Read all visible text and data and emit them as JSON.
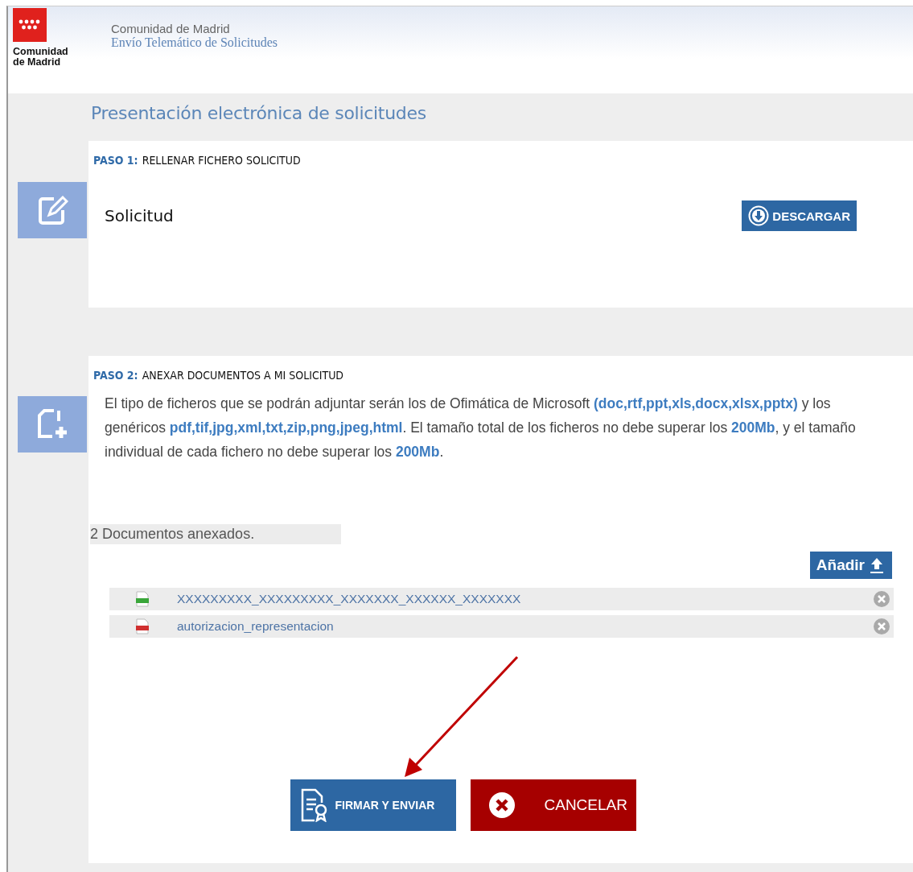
{
  "header": {
    "logo_text": "Comunidad de Madrid",
    "org": "Comunidad de Madrid",
    "app": "Envío Telemático de Solicitudes"
  },
  "title": "Presentación electrónica de solicitudes",
  "step1": {
    "label": "PASO 1:",
    "heading": "RELLENAR FICHERO SOLICITUD",
    "item": "Solicitud",
    "button": "DESCARGAR"
  },
  "step2": {
    "label": "PASO 2:",
    "heading": "ANEXAR DOCUMENTOS A MI SOLICITUD",
    "description": "El tipo de ficheros que se podrán adjuntar serán los de Ofimática de Microsoft **(doc,rtf,ppt,xls,docx,xlsx,pptx)** y los genéricos **pdf,tif,jpg,xml,txt,zip,png,jpeg,html**. El tamaño total de los ficheros no debe superar los **200Mb**, y el tamaño individual de cada fichero no debe superar los **200Mb**.",
    "count": "2 Documentos anexados.",
    "add_button": "Añadir",
    "documents": [
      {
        "kind": "xls",
        "name": "XXXXXXXXX_XXXXXXXXX_XXXXXXX_XXXXXX_XXXXXXX"
      },
      {
        "kind": "pdf",
        "name": "autorizacion_representacion"
      }
    ]
  },
  "actions": {
    "sign": "FIRMAR Y ENVIAR",
    "cancel": "CANCELAR"
  },
  "annotation": {
    "kind": "arrow"
  }
}
